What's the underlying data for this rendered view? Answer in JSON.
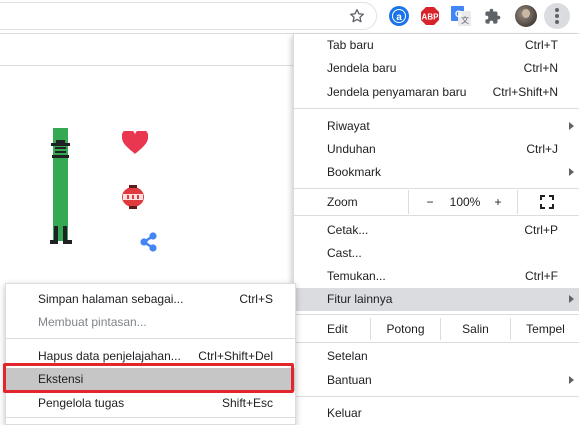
{
  "toolbar": {
    "star_icon": "star-outline-icon",
    "extensions": {
      "a_label": "a",
      "abp_label": "ABP",
      "translate_glyph": "文"
    },
    "more_menu_icon": "vertical-dots-icon"
  },
  "main_menu": {
    "new_tab": {
      "label": "Tab baru",
      "shortcut": "Ctrl+T"
    },
    "new_window": {
      "label": "Jendela baru",
      "shortcut": "Ctrl+N"
    },
    "incognito": {
      "label": "Jendela penyamaran baru",
      "shortcut": "Ctrl+Shift+N"
    },
    "history": {
      "label": "Riwayat"
    },
    "downloads": {
      "label": "Unduhan",
      "shortcut": "Ctrl+J"
    },
    "bookmarks": {
      "label": "Bookmark"
    },
    "zoom": {
      "label": "Zoom",
      "minus": "−",
      "value": "100%",
      "plus": "+"
    },
    "print": {
      "label": "Cetak...",
      "shortcut": "Ctrl+P"
    },
    "cast": {
      "label": "Cast..."
    },
    "find": {
      "label": "Temukan...",
      "shortcut": "Ctrl+F"
    },
    "more_tools": {
      "label": "Fitur lainnya"
    },
    "edit": {
      "label": "Edit",
      "cut": "Potong",
      "copy": "Salin",
      "paste": "Tempel"
    },
    "settings": {
      "label": "Setelan"
    },
    "help": {
      "label": "Bantuan"
    },
    "exit": {
      "label": "Keluar"
    }
  },
  "sub_menu": {
    "save_page": {
      "label": "Simpan halaman sebagai...",
      "shortcut": "Ctrl+S"
    },
    "create_shortcut": {
      "label": "Membuat pintasan..."
    },
    "clear_data": {
      "label": "Hapus data penjelajahan...",
      "shortcut": "Ctrl+Shift+Del"
    },
    "extensions": {
      "label": "Ekstensi"
    },
    "task_manager": {
      "label": "Pengelola tugas",
      "shortcut": "Shift+Esc"
    }
  },
  "colors": {
    "highlight_border": "#e3262b",
    "menu_highlight": "#dadce0",
    "doodle_green": "#34a853",
    "heart_red": "#e8374f",
    "share_blue": "#4285f4"
  }
}
